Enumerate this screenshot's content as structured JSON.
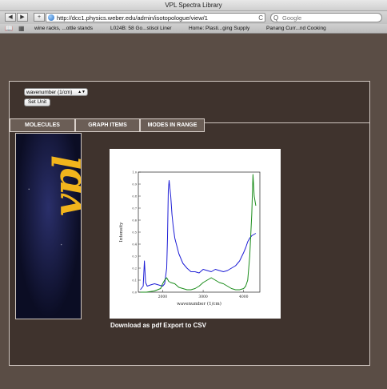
{
  "browser": {
    "window_title": "VPL Spectra Library",
    "url": "http://dcc1.physics.weber.edu/admin/isotopologue/view/1",
    "search_placeholder": "Google",
    "back_glyph": "◀",
    "forward_glyph": "▶",
    "add_glyph": "+",
    "reload_glyph": "C",
    "search_glyph": "Q",
    "bookmarks": [
      "wine racks, ...ottle stands",
      "L024B: 58 Go...stisol Liner",
      "Home: Plasti...ging Supply",
      "Panang Curr...nd Cooking"
    ]
  },
  "page": {
    "unit_select_value": "wavenumber (1/cm)",
    "set_unit_label": "Set Unit",
    "tabs": [
      "MOLECULES",
      "GRAPH ITEMS",
      "MODES IN RANGE"
    ],
    "banner_logo": "vpl",
    "download_pdf_label": "Download as pdf",
    "export_csv_label": "Export to CSV"
  },
  "chart_data": {
    "type": "line",
    "title": "",
    "xlabel": "wavenumber (1/cm)",
    "ylabel": "Intensity",
    "xlim": [
      1400,
      4400
    ],
    "ylim": [
      0,
      1.0
    ],
    "xticks": [
      2000,
      3000,
      4000
    ],
    "yticks": [
      0,
      0.1,
      0.2,
      0.3,
      0.4,
      0.5,
      0.6,
      0.7,
      0.8,
      0.9,
      1.0
    ],
    "series": [
      {
        "color": "#1f1fd6",
        "x": [
          1450,
          1520,
          1550,
          1580,
          1620,
          1700,
          1800,
          1900,
          2000,
          2050,
          2100,
          2120,
          2140,
          2160,
          2200,
          2230,
          2260,
          2300,
          2400,
          2500,
          2600,
          2700,
          2800,
          2900,
          3000,
          3100,
          3200,
          3300,
          3400,
          3500,
          3600,
          3700,
          3800,
          3900,
          4000,
          4050,
          4100,
          4150,
          4200,
          4250,
          4300
        ],
        "y": [
          0.02,
          0.05,
          0.26,
          0.08,
          0.05,
          0.06,
          0.07,
          0.06,
          0.05,
          0.07,
          0.2,
          0.45,
          0.85,
          0.93,
          0.8,
          0.65,
          0.55,
          0.45,
          0.32,
          0.24,
          0.2,
          0.17,
          0.17,
          0.16,
          0.19,
          0.18,
          0.17,
          0.19,
          0.18,
          0.17,
          0.18,
          0.2,
          0.22,
          0.26,
          0.33,
          0.37,
          0.42,
          0.45,
          0.47,
          0.48,
          0.49
        ]
      },
      {
        "color": "#1a8c1a",
        "x": [
          1450,
          1600,
          1800,
          1950,
          2000,
          2050,
          2100,
          2150,
          2200,
          2300,
          2400,
          2500,
          2600,
          2700,
          2800,
          2900,
          3000,
          3100,
          3200,
          3300,
          3400,
          3500,
          3600,
          3700,
          3800,
          3900,
          4000,
          4050,
          4100,
          4150,
          4200,
          4230,
          4260,
          4300
        ],
        "y": [
          0.0,
          0.0,
          0.01,
          0.03,
          0.07,
          0.1,
          0.12,
          0.09,
          0.08,
          0.07,
          0.04,
          0.03,
          0.02,
          0.02,
          0.03,
          0.05,
          0.08,
          0.1,
          0.12,
          0.1,
          0.08,
          0.07,
          0.05,
          0.03,
          0.02,
          0.02,
          0.03,
          0.05,
          0.1,
          0.3,
          0.65,
          0.98,
          0.8,
          0.72
        ]
      }
    ]
  }
}
